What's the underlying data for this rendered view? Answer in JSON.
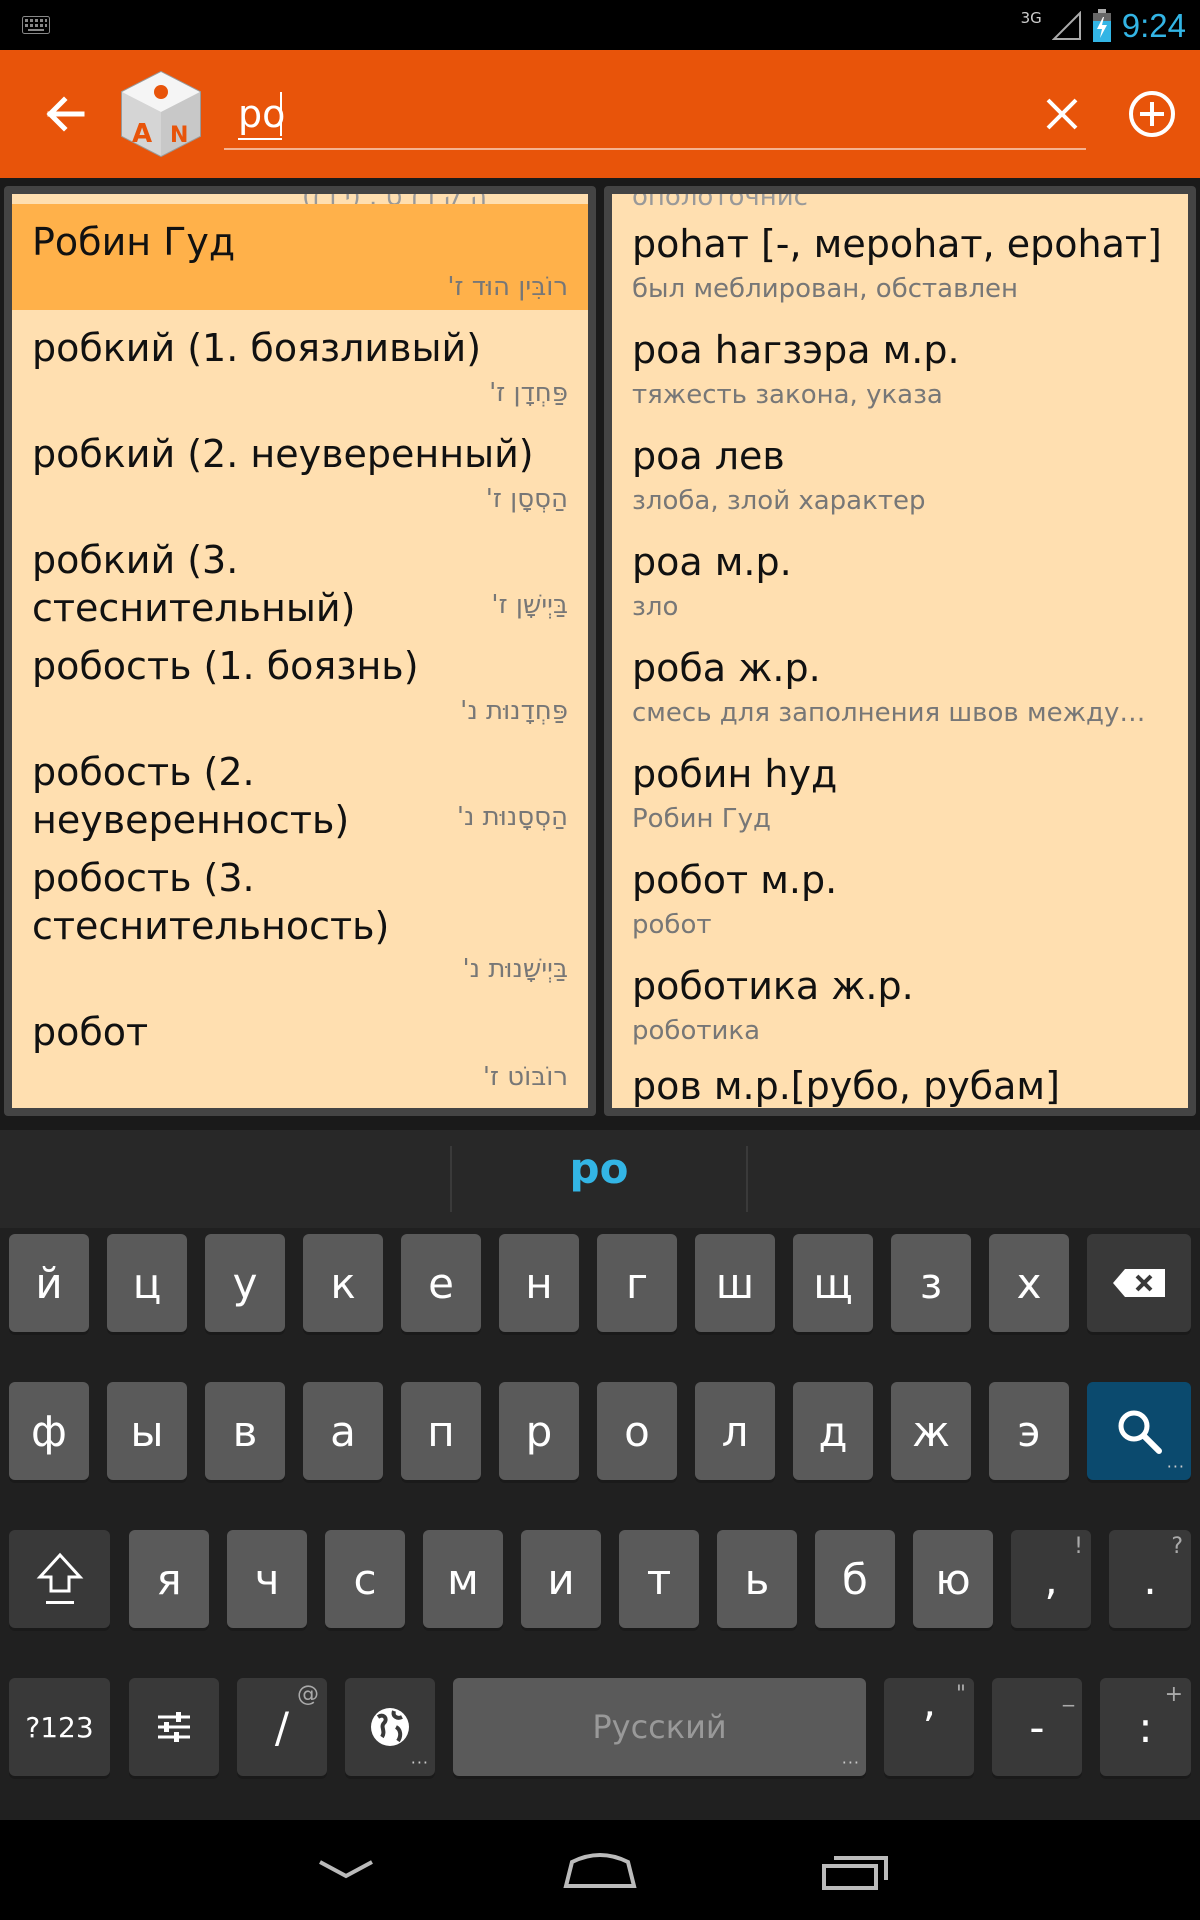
{
  "status": {
    "network": "3G",
    "time": "9:24"
  },
  "search": {
    "query": "ро"
  },
  "left_list": {
    "items": [
      {
        "main": "Робин Гуд",
        "sub": "רוֹבִּין הוּד ז'",
        "selected": true
      },
      {
        "main": "робкий (1. боязливый)",
        "sub": "פַּחְדָן ז'"
      },
      {
        "main": "робкий (2. неуверенный)",
        "sub": "הַסְסָן ז'"
      },
      {
        "main": "робкий (3. стеснительный)",
        "sub": "בַּיְישָׁן ז'"
      },
      {
        "main": "робость (1. боязнь)",
        "sub": "פַּחְדָנוּת נ'"
      },
      {
        "main": "робость (2. неуверенность)",
        "sub": "הַסְסָנוּת נ'"
      },
      {
        "main": "робость (3. стеснительность)",
        "sub": "בַּיְישָׁנוּת נ'"
      },
      {
        "main": "робот",
        "sub": "רוֹבּוֹט ז'"
      }
    ]
  },
  "right_list": {
    "items": [
      {
        "main": "роһат [-, мероһат, ероһат]",
        "sub": "был меблирован, обставлен"
      },
      {
        "main": "роа һагзэра м.р.",
        "sub": "тяжесть закона, указа"
      },
      {
        "main": "роа лев",
        "sub": "злоба, злой характер"
      },
      {
        "main": "роа м.р.",
        "sub": "зло"
      },
      {
        "main": "роба ж.р.",
        "sub": "смесь для заполнения швов между…"
      },
      {
        "main": "робин һуд",
        "sub": "Робин Гуд"
      },
      {
        "main": "робот м.р.",
        "sub": "робот"
      },
      {
        "main": "роботика ж.р.",
        "sub": "роботика"
      },
      {
        "main": "ров м.р.[рубо, рубам]",
        "sub": ""
      }
    ]
  },
  "keyboard": {
    "suggestion": "ро",
    "row1": [
      "й",
      "ц",
      "у",
      "к",
      "е",
      "н",
      "г",
      "ш",
      "щ",
      "з",
      "х"
    ],
    "row2": [
      "ф",
      "ы",
      "в",
      "а",
      "п",
      "р",
      "о",
      "л",
      "д",
      "ж",
      "э"
    ],
    "row3": [
      "я",
      "ч",
      "с",
      "м",
      "и",
      "т",
      "ь",
      "б",
      "ю"
    ],
    "comma": ",",
    "comma_hint": "!",
    "period": ".",
    "period_hint": "?",
    "symbols_label": "?123",
    "slash": "/",
    "slash_hint": "@",
    "space_label": "Русский",
    "apostrophe": "’",
    "apostrophe_hint": "\"",
    "dash": "-",
    "dash_hint": "_",
    "colon": ":",
    "colon_hint": "+"
  }
}
